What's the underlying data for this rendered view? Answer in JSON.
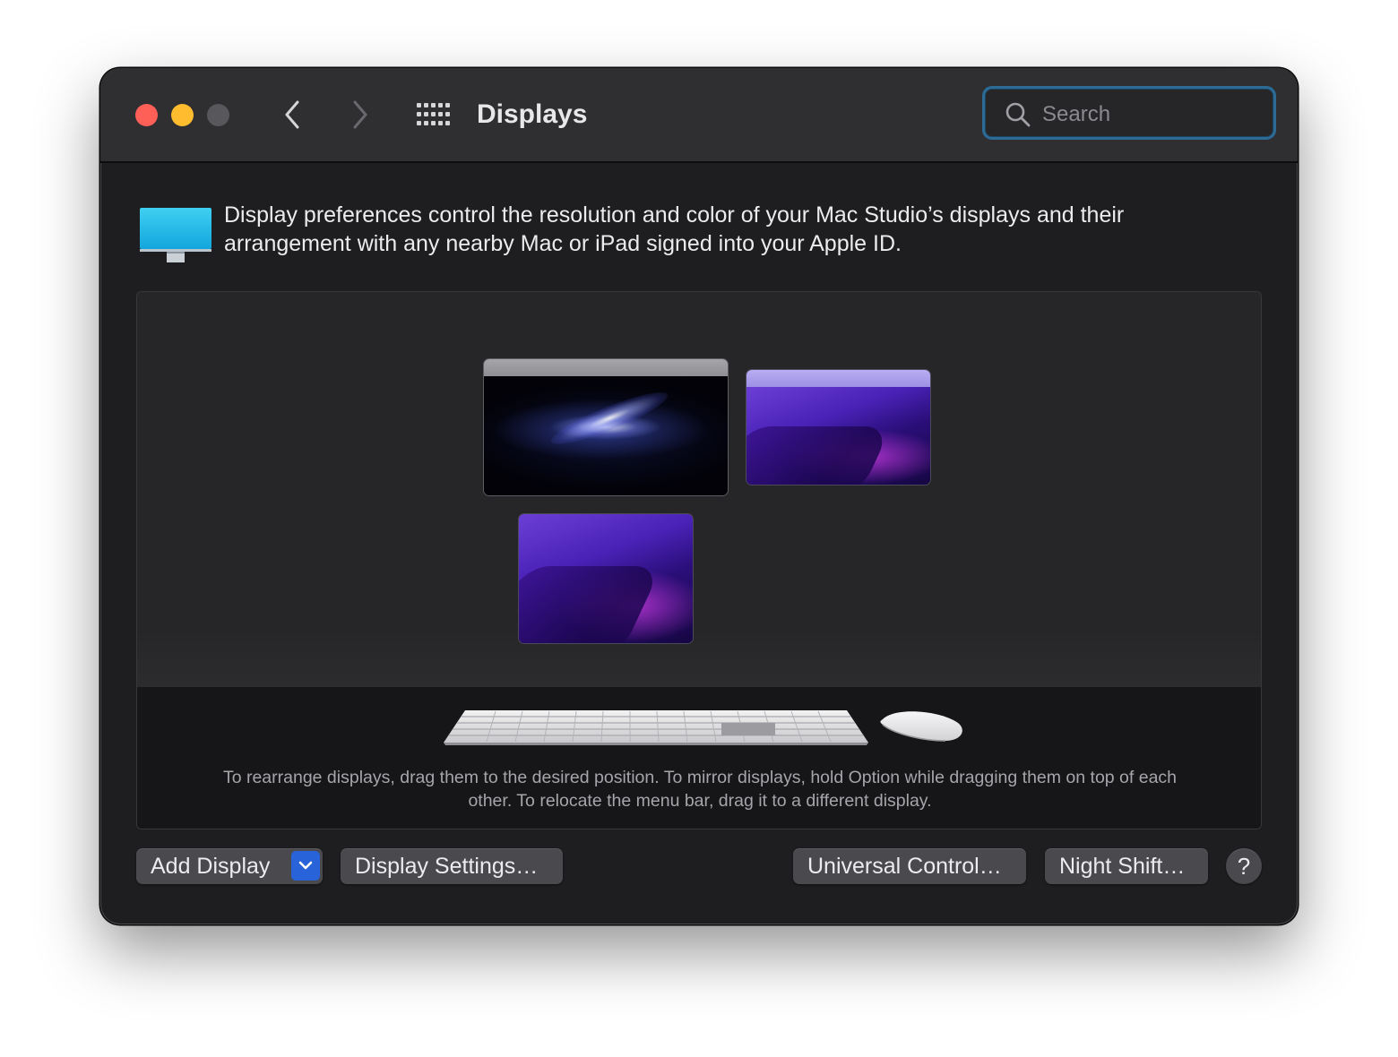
{
  "window": {
    "title": "Displays"
  },
  "search": {
    "placeholder": "Search"
  },
  "header": {
    "description": "Display preferences control the resolution and color of your Mac Studio’s displays and their arrangement with any nearby Mac or iPad signed into your Apple ID."
  },
  "arrangement": {
    "hint": "To rearrange displays, drag them to the desired position. To mirror displays, hold Option while dragging them on top of each other. To relocate the menu bar, drag it to a different display."
  },
  "buttons": {
    "add_display": "Add Display",
    "display_settings": "Display Settings…",
    "universal_control": "Universal Control…",
    "night_shift": "Night Shift…",
    "help": "?"
  },
  "icons": {
    "close": "close-icon",
    "minimize": "minimize-icon",
    "zoom": "zoom-icon",
    "back": "chevron-left-icon",
    "forward": "chevron-right-icon",
    "show_all": "grid-icon",
    "search": "search-icon",
    "display_pref": "display-icon",
    "dropdown": "chevron-down-icon"
  },
  "colors": {
    "accent": "#2963d9",
    "search_focus": "#2c6b96",
    "close": "#fe5f57",
    "minimize": "#febc2e",
    "zoom_disabled": "#58585c"
  }
}
